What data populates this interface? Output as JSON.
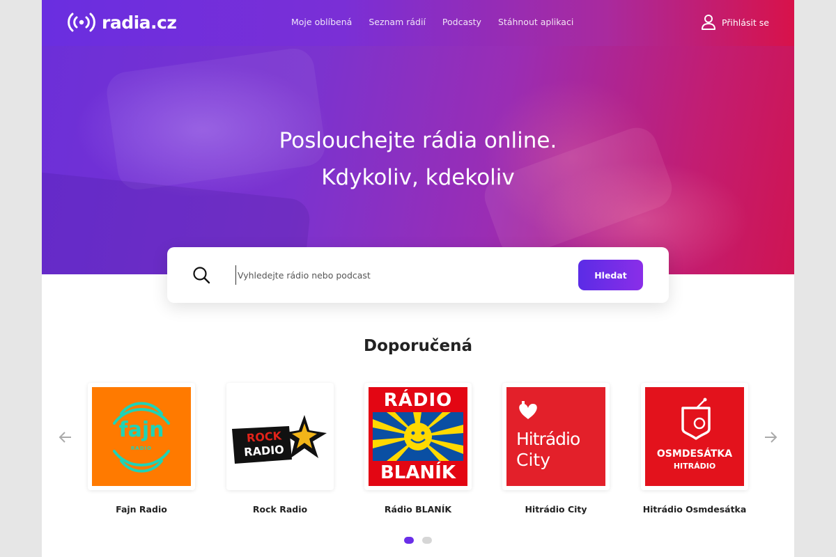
{
  "header": {
    "logo_text": "radia.cz",
    "nav": [
      {
        "label": "Moje oblíbená"
      },
      {
        "label": "Seznam rádií"
      },
      {
        "label": "Podcasty"
      },
      {
        "label": "Stáhnout aplikaci"
      }
    ],
    "login_label": "Přihlásit se"
  },
  "hero": {
    "title_line1": "Poslouchejte rádia online.",
    "title_line2": "Kdykoliv, kdekoliv"
  },
  "search": {
    "placeholder": "Vyhledejte rádio nebo podcast",
    "button_label": "Hledat"
  },
  "recommended": {
    "title": "Doporučená",
    "stations": [
      {
        "name": "Fajn Radio",
        "logo": {
          "line1": "fajn",
          "line2": "RADIO",
          "bg": "#ff7a00",
          "fg": "#1fd3b6"
        }
      },
      {
        "name": "Rock Radio",
        "logo": {
          "line1": "ROCK",
          "line2": "RADIO",
          "bg": "#ffffff",
          "fg": "#e2231a"
        }
      },
      {
        "name": "Rádio BLANÍK",
        "logo": {
          "line1": "RÁDIO",
          "line2": "BLANÍK",
          "bg": "#e30613",
          "fg": "#ffffff"
        }
      },
      {
        "name": "Hitrádio City",
        "logo": {
          "line1": "Hitrádio",
          "line2": "City",
          "bg": "#e3202a",
          "fg": "#ffffff"
        }
      },
      {
        "name": "Hitrádio Osmdesátka",
        "logo": {
          "line1": "OSMDESÁTKA",
          "line2": "HITRÁDIO",
          "bg": "#e3121c",
          "fg": "#ffffff"
        }
      }
    ],
    "pages": 2,
    "active_page": 1
  },
  "colors": {
    "brand_purple": "#6a2ee8",
    "brand_red": "#d8124a"
  }
}
